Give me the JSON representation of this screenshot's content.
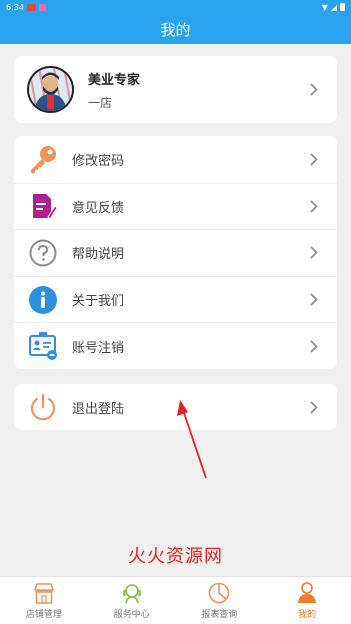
{
  "status_bar": {
    "time": "6:34"
  },
  "header": {
    "title": "我的"
  },
  "profile": {
    "name": "美业专家",
    "store": "一店"
  },
  "menu": [
    {
      "label": "修改密码",
      "icon": "key-icon",
      "color": "#f0935a"
    },
    {
      "label": "意见反馈",
      "icon": "feedback-edit-icon",
      "color": "#b0208e"
    },
    {
      "label": "帮助说明",
      "icon": "question-circle-icon",
      "color": "#8a8a8a"
    },
    {
      "label": "关于我们",
      "icon": "info-circle-icon",
      "color": "#2f8fe0"
    },
    {
      "label": "账号注销",
      "icon": "id-card-icon",
      "color": "#2f8fe0"
    }
  ],
  "logout": {
    "label": "退出登陆",
    "icon": "power-icon",
    "color": "#f0935a"
  },
  "watermark": "火火资源网",
  "bottom_nav": [
    {
      "label": "店铺管理",
      "icon": "store-icon",
      "active": false
    },
    {
      "label": "服务中心",
      "icon": "service-icon",
      "active": false
    },
    {
      "label": "报表查询",
      "icon": "report-icon",
      "active": false
    },
    {
      "label": "我的",
      "icon": "user-icon",
      "active": true
    }
  ],
  "colors": {
    "primary": "#2aa3ef",
    "accent": "#ef7a2e",
    "annotation": "#e52222"
  }
}
